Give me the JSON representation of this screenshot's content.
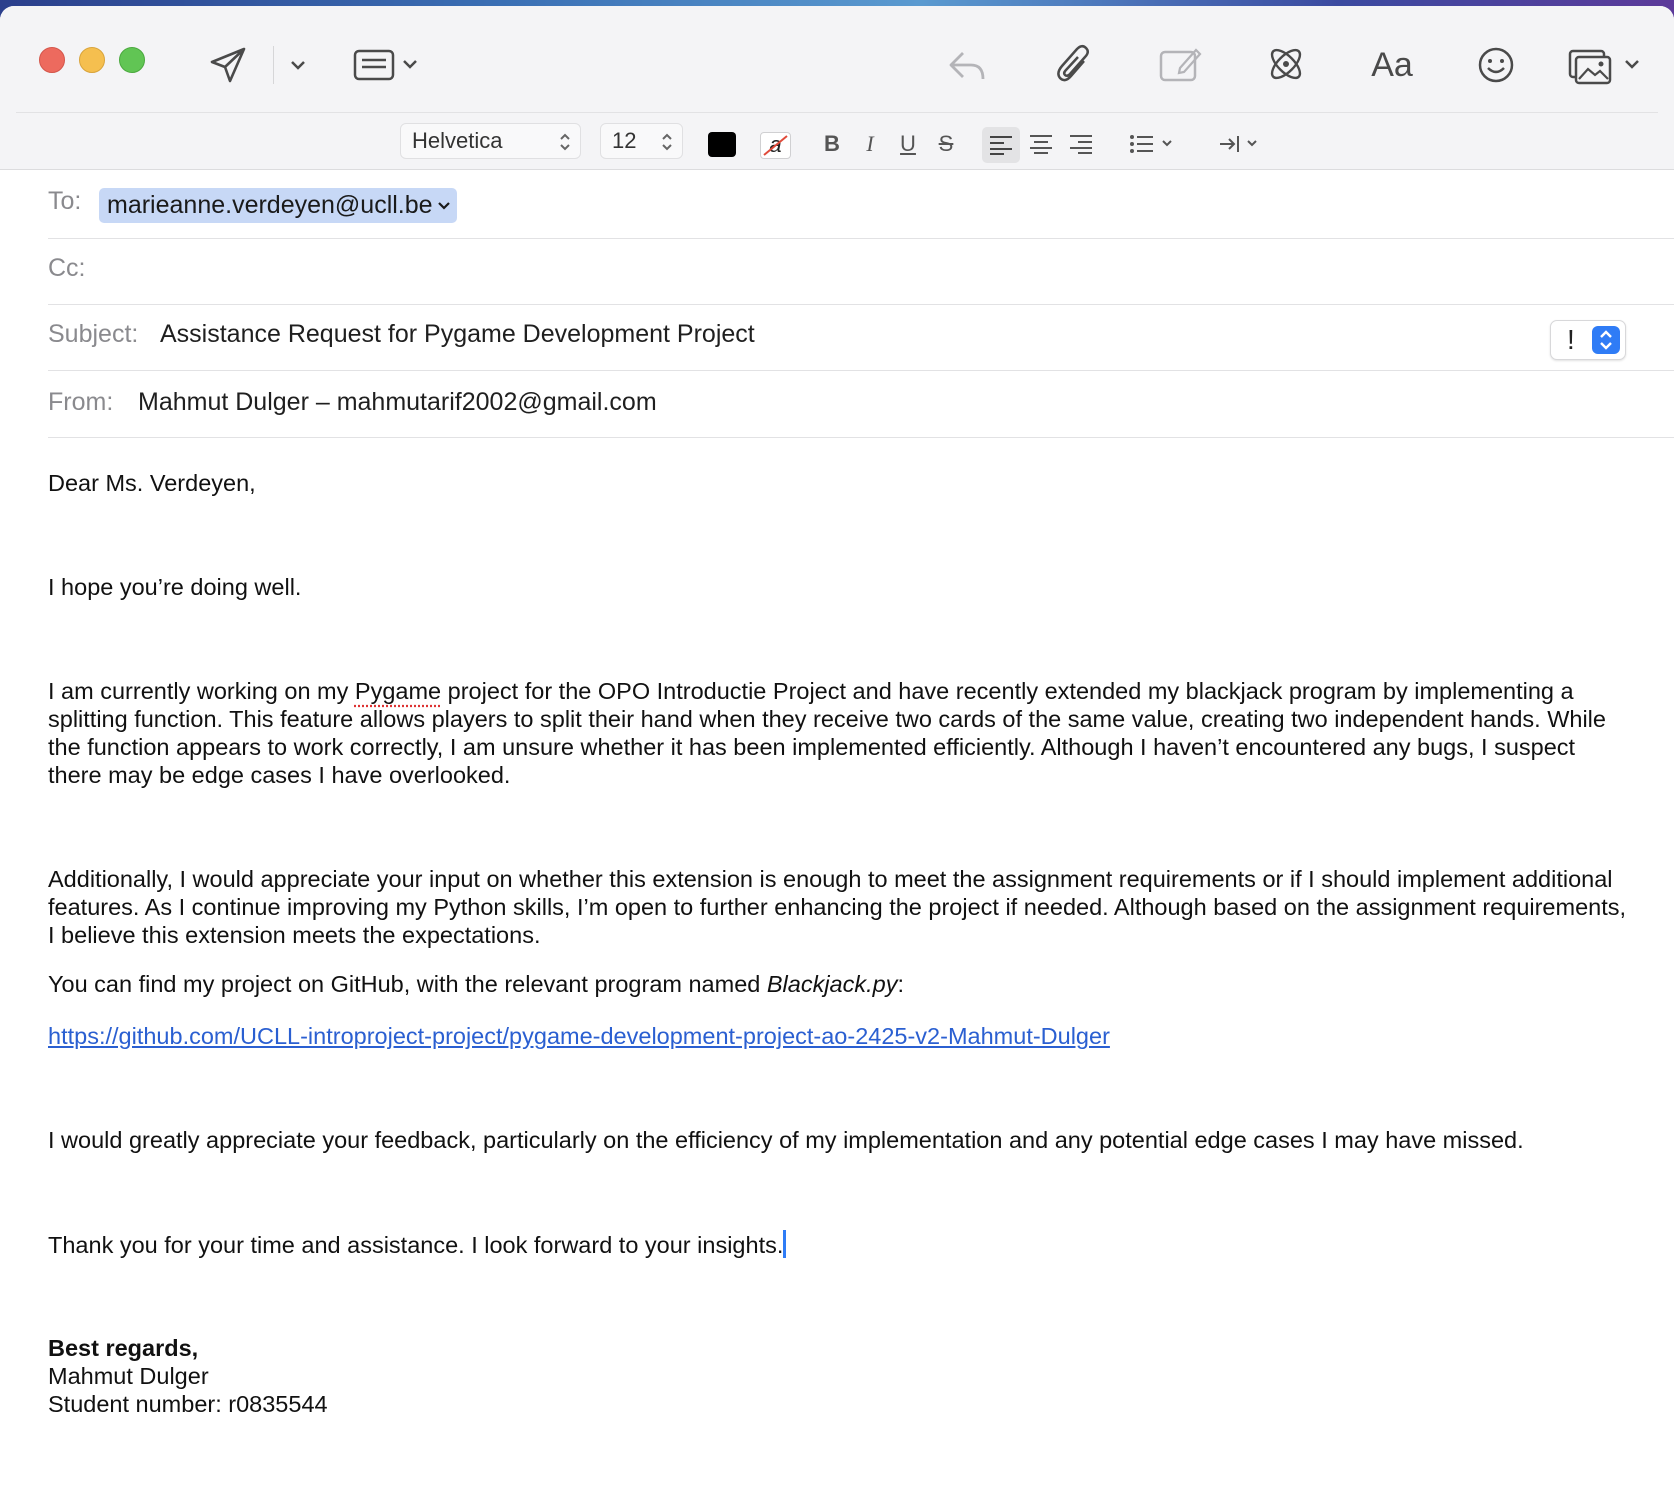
{
  "toolbar": {
    "font_family": "Helvetica",
    "font_size": "12",
    "text_color": "#000000",
    "fmt_bold": "B",
    "fmt_italic": "I",
    "fmt_underline": "U",
    "fmt_strike": "S",
    "bg_color_glyph": "a",
    "font_panel_label": "Aa"
  },
  "header": {
    "to_label": "To:",
    "to_recipient": "marieanne.verdeyen@ucll.be",
    "cc_label": "Cc:",
    "cc_value": "",
    "subject_label": "Subject:",
    "subject_value": "Assistance Request for Pygame Development Project",
    "priority_glyph": "!",
    "from_label": "From:",
    "from_value": "Mahmut Dulger – mahmutarif2002@gmail.com"
  },
  "body": {
    "greeting": "Dear Ms. Verdeyen,",
    "hope": "I hope you’re doing well.",
    "p1_pre": "I am currently working on my ",
    "p1_pygame": "Pygame",
    "p1_post": " project for the OPO Introductie Project and have recently extended my blackjack program by implementing a splitting function. This feature allows players to split their hand when they receive two cards of the same value, creating two independent hands. While the function appears to work correctly, I am unsure whether it has been implemented efficiently. Although I haven’t encountered any bugs, I suspect there may be edge cases I have overlooked.",
    "p2": "Additionally, I would appreciate your input on whether this extension is enough to meet the assignment requirements or if I should implement additional features. As I continue improving my Python skills, I’m open to further enhancing the project if needed. Although based on the assignment requirements, I believe this extension meets the expectations.",
    "p3_pre": "You can find my project on GitHub, with the relevant program named ",
    "p3_file": "Blackjack.py",
    "p3_post": ":",
    "link": "https://github.com/UCLL-introproject-project/pygame-development-project-ao-2425-v2-Mahmut-Dulger",
    "p4": "I would greatly appreciate your feedback, particularly on the efficiency of my implementation and any potential edge cases I may have missed.",
    "p5": "Thank you for your time and assistance. I look forward to your insights.",
    "sign_off": "Best regards,",
    "name": "Mahmut Dulger",
    "student_number": "Student number: r0835544"
  },
  "icons": [
    "send-icon",
    "chevron-down-icon",
    "header-fields-icon",
    "reply-icon",
    "paperclip-icon",
    "markup-icon",
    "writing-tools-icon",
    "emoji-icon",
    "photo-browser-icon"
  ],
  "colors": {
    "accent": "#2f7cf6",
    "link": "#2a5fd1",
    "token_bg": "#c7d8f6"
  }
}
